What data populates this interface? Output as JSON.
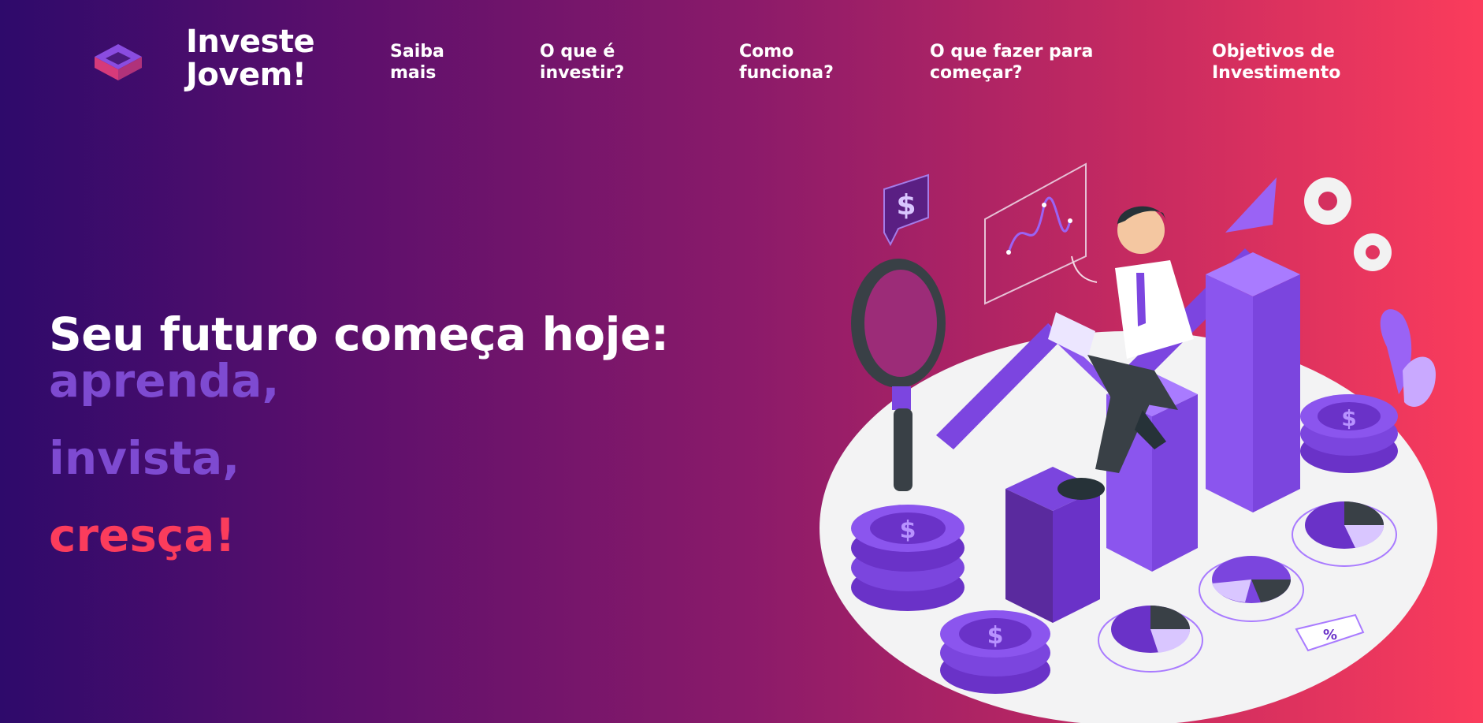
{
  "header": {
    "brand": "Investe\nJovem!",
    "logo_icon": "isometric-cube-icon",
    "nav": [
      {
        "label": "Saiba\nmais"
      },
      {
        "label": "O que é\ninvestir?"
      },
      {
        "label": "Como\nfunciona?"
      },
      {
        "label": "O que fazer para\ncomeçar?"
      },
      {
        "label": "Objetivos de\nInvestimento"
      }
    ]
  },
  "hero": {
    "title": "Seu futuro começa hoje:",
    "lines": [
      "aprenda,",
      "invista,",
      "cresça!"
    ]
  },
  "illustration": {
    "subject": "investment-growth-illustration",
    "badge_symbol": "%"
  },
  "colors": {
    "gradient_start": "#2e0a6b",
    "gradient_end": "#fb3c5c",
    "accent_purple": "#7e4ad1",
    "accent_pink": "#fb3c5c"
  }
}
